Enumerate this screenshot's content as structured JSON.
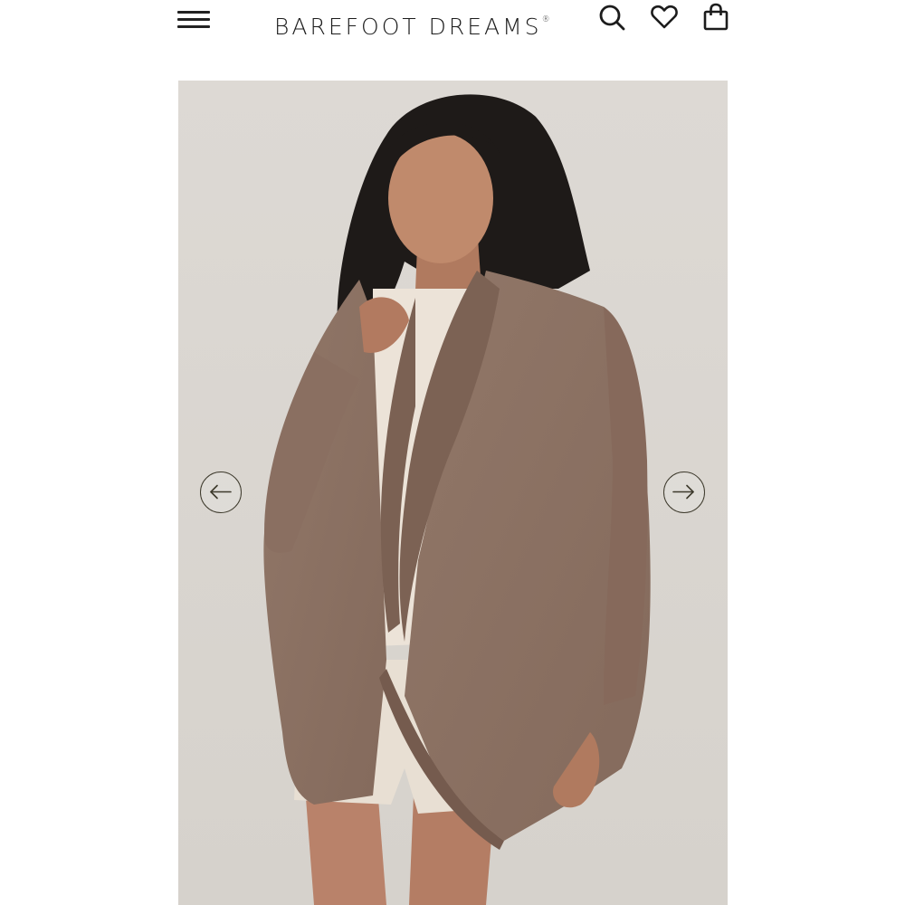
{
  "header": {
    "brand": "BAREFOOT DREAMS",
    "brand_mark": "®",
    "icons": [
      "menu-icon",
      "search-icon",
      "heart-icon",
      "shopping-bag-icon"
    ]
  },
  "gallery": {
    "image": "product-photo",
    "prev_icon": "arrow-left-icon",
    "next_icon": "arrow-right-icon",
    "colors": {
      "background": "#dcd8d3",
      "cardigan": "#8c7264",
      "top": "#ece3d8",
      "arrow_border": "#3d3a2c"
    }
  }
}
